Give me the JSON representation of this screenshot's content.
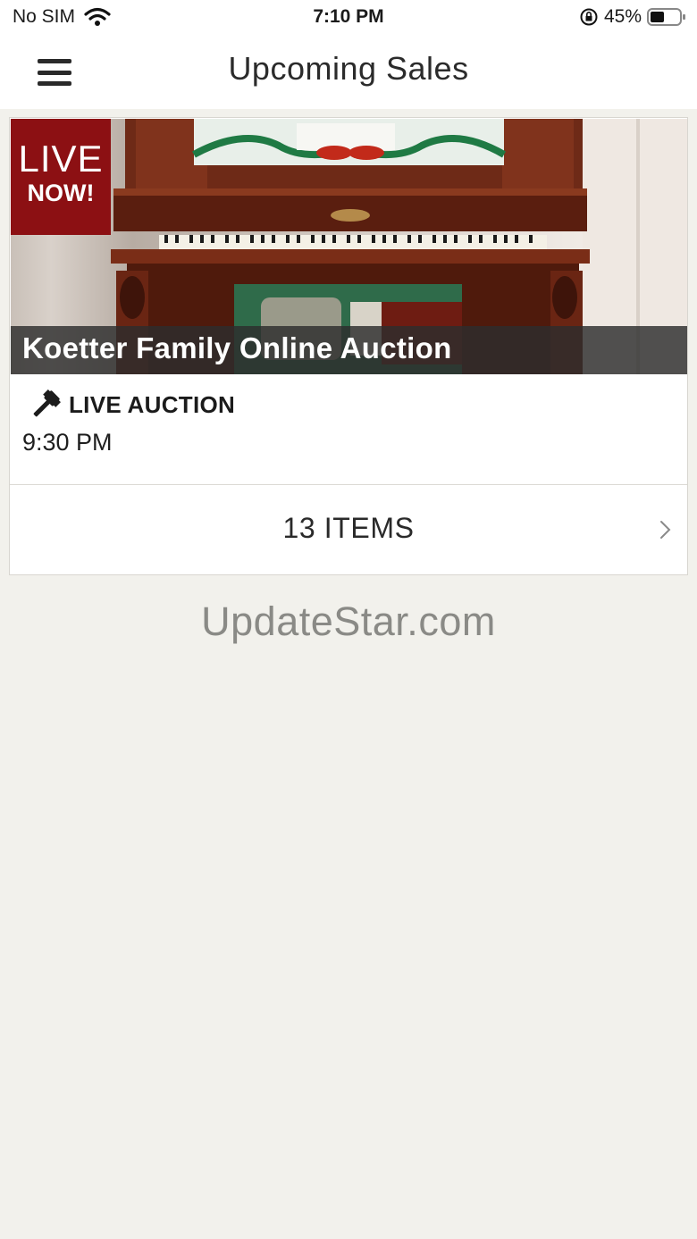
{
  "status_bar": {
    "carrier": "No SIM",
    "time": "7:10 PM",
    "battery": "45%"
  },
  "nav": {
    "title": "Upcoming Sales"
  },
  "sale": {
    "badge_line1": "LIVE",
    "badge_line2": "NOW!",
    "title": "Koetter Family Online Auction",
    "type_label": "LIVE AUCTION",
    "time": "9:30 PM",
    "items_label": "13 ITEMS"
  },
  "watermark": "UpdateStar.com",
  "colors": {
    "badge": "#8c1013",
    "background": "#f2f1ec"
  },
  "icons": [
    "menu-icon",
    "wifi-icon",
    "lock-rotation-icon",
    "battery-icon",
    "gavel-icon",
    "chevron-right-icon"
  ]
}
